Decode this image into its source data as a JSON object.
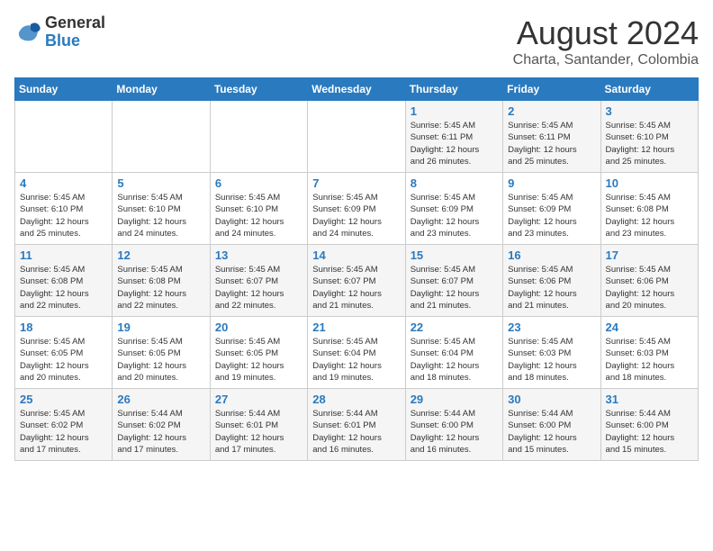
{
  "logo": {
    "general": "General",
    "blue": "Blue"
  },
  "header": {
    "month_year": "August 2024",
    "location": "Charta, Santander, Colombia"
  },
  "weekdays": [
    "Sunday",
    "Monday",
    "Tuesday",
    "Wednesday",
    "Thursday",
    "Friday",
    "Saturday"
  ],
  "weeks": [
    [
      {
        "day": "",
        "info": ""
      },
      {
        "day": "",
        "info": ""
      },
      {
        "day": "",
        "info": ""
      },
      {
        "day": "",
        "info": ""
      },
      {
        "day": "1",
        "info": "Sunrise: 5:45 AM\nSunset: 6:11 PM\nDaylight: 12 hours\nand 26 minutes."
      },
      {
        "day": "2",
        "info": "Sunrise: 5:45 AM\nSunset: 6:11 PM\nDaylight: 12 hours\nand 25 minutes."
      },
      {
        "day": "3",
        "info": "Sunrise: 5:45 AM\nSunset: 6:10 PM\nDaylight: 12 hours\nand 25 minutes."
      }
    ],
    [
      {
        "day": "4",
        "info": "Sunrise: 5:45 AM\nSunset: 6:10 PM\nDaylight: 12 hours\nand 25 minutes."
      },
      {
        "day": "5",
        "info": "Sunrise: 5:45 AM\nSunset: 6:10 PM\nDaylight: 12 hours\nand 24 minutes."
      },
      {
        "day": "6",
        "info": "Sunrise: 5:45 AM\nSunset: 6:10 PM\nDaylight: 12 hours\nand 24 minutes."
      },
      {
        "day": "7",
        "info": "Sunrise: 5:45 AM\nSunset: 6:09 PM\nDaylight: 12 hours\nand 24 minutes."
      },
      {
        "day": "8",
        "info": "Sunrise: 5:45 AM\nSunset: 6:09 PM\nDaylight: 12 hours\nand 23 minutes."
      },
      {
        "day": "9",
        "info": "Sunrise: 5:45 AM\nSunset: 6:09 PM\nDaylight: 12 hours\nand 23 minutes."
      },
      {
        "day": "10",
        "info": "Sunrise: 5:45 AM\nSunset: 6:08 PM\nDaylight: 12 hours\nand 23 minutes."
      }
    ],
    [
      {
        "day": "11",
        "info": "Sunrise: 5:45 AM\nSunset: 6:08 PM\nDaylight: 12 hours\nand 22 minutes."
      },
      {
        "day": "12",
        "info": "Sunrise: 5:45 AM\nSunset: 6:08 PM\nDaylight: 12 hours\nand 22 minutes."
      },
      {
        "day": "13",
        "info": "Sunrise: 5:45 AM\nSunset: 6:07 PM\nDaylight: 12 hours\nand 22 minutes."
      },
      {
        "day": "14",
        "info": "Sunrise: 5:45 AM\nSunset: 6:07 PM\nDaylight: 12 hours\nand 21 minutes."
      },
      {
        "day": "15",
        "info": "Sunrise: 5:45 AM\nSunset: 6:07 PM\nDaylight: 12 hours\nand 21 minutes."
      },
      {
        "day": "16",
        "info": "Sunrise: 5:45 AM\nSunset: 6:06 PM\nDaylight: 12 hours\nand 21 minutes."
      },
      {
        "day": "17",
        "info": "Sunrise: 5:45 AM\nSunset: 6:06 PM\nDaylight: 12 hours\nand 20 minutes."
      }
    ],
    [
      {
        "day": "18",
        "info": "Sunrise: 5:45 AM\nSunset: 6:05 PM\nDaylight: 12 hours\nand 20 minutes."
      },
      {
        "day": "19",
        "info": "Sunrise: 5:45 AM\nSunset: 6:05 PM\nDaylight: 12 hours\nand 20 minutes."
      },
      {
        "day": "20",
        "info": "Sunrise: 5:45 AM\nSunset: 6:05 PM\nDaylight: 12 hours\nand 19 minutes."
      },
      {
        "day": "21",
        "info": "Sunrise: 5:45 AM\nSunset: 6:04 PM\nDaylight: 12 hours\nand 19 minutes."
      },
      {
        "day": "22",
        "info": "Sunrise: 5:45 AM\nSunset: 6:04 PM\nDaylight: 12 hours\nand 18 minutes."
      },
      {
        "day": "23",
        "info": "Sunrise: 5:45 AM\nSunset: 6:03 PM\nDaylight: 12 hours\nand 18 minutes."
      },
      {
        "day": "24",
        "info": "Sunrise: 5:45 AM\nSunset: 6:03 PM\nDaylight: 12 hours\nand 18 minutes."
      }
    ],
    [
      {
        "day": "25",
        "info": "Sunrise: 5:45 AM\nSunset: 6:02 PM\nDaylight: 12 hours\nand 17 minutes."
      },
      {
        "day": "26",
        "info": "Sunrise: 5:44 AM\nSunset: 6:02 PM\nDaylight: 12 hours\nand 17 minutes."
      },
      {
        "day": "27",
        "info": "Sunrise: 5:44 AM\nSunset: 6:01 PM\nDaylight: 12 hours\nand 17 minutes."
      },
      {
        "day": "28",
        "info": "Sunrise: 5:44 AM\nSunset: 6:01 PM\nDaylight: 12 hours\nand 16 minutes."
      },
      {
        "day": "29",
        "info": "Sunrise: 5:44 AM\nSunset: 6:00 PM\nDaylight: 12 hours\nand 16 minutes."
      },
      {
        "day": "30",
        "info": "Sunrise: 5:44 AM\nSunset: 6:00 PM\nDaylight: 12 hours\nand 15 minutes."
      },
      {
        "day": "31",
        "info": "Sunrise: 5:44 AM\nSunset: 6:00 PM\nDaylight: 12 hours\nand 15 minutes."
      }
    ]
  ]
}
